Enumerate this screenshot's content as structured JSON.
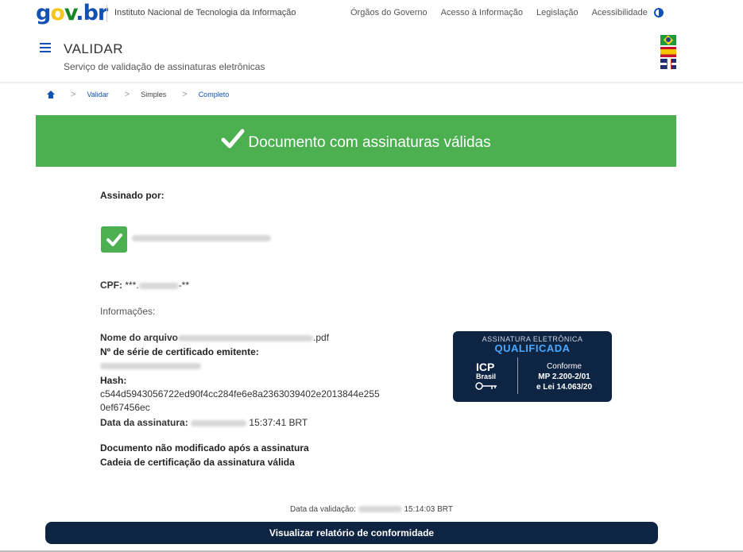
{
  "topbar": {
    "logo": {
      "g": "g",
      "o": "o",
      "v": "v",
      "dot": ".",
      "b": "b",
      "r": "r"
    },
    "institute": "Instituto Nacional de Tecnologia da Informação",
    "nav": [
      "Órgãos do Governo",
      "Acesso à Informação",
      "Legislação",
      "Acessibilidade"
    ],
    "contrast_icon": "contrast-icon"
  },
  "header": {
    "title": "VALIDAR",
    "subtitle": "Serviço de validação de assinaturas eletrônicas",
    "languages": [
      "flag-brazil-icon",
      "flag-spain-icon",
      "flag-uk-icon"
    ]
  },
  "breadcrumb": {
    "home_icon": "home-icon",
    "items": [
      {
        "label": "Validar"
      },
      {
        "label": "Simples"
      },
      {
        "label": "Completo"
      }
    ],
    "separator": ">"
  },
  "banner": {
    "text": "Documento com assinaturas válidas",
    "icon": "checkmark-icon",
    "color": "#4caf50"
  },
  "signature": {
    "signed_by_label": "Assinado por:",
    "cpf_label": "CPF:",
    "cpf_prefix": "***.",
    "cpf_suffix": "-**",
    "info_label": "Informações:",
    "filename_label": "Nome do arquivo",
    "filename_suffix": ".pdf",
    "serial_label": "Nº de série de certificado emitente:",
    "hash_label": "Hash:",
    "hash_line1": "c544d5943056722ed90f4cc284fe6e8a2363039402e2013844e255",
    "hash_line2": "0ef67456ec",
    "date_label": "Data da assinatura:",
    "date_time": "15:37:41 BRT",
    "status1": "Documento não modificado após a assinatura",
    "status2": "Cadeia de certificação da assinatura válida"
  },
  "badge": {
    "line1": "ASSINATURA ELETRÔNICA",
    "line2": "QUALIFICADA",
    "icp": "ICP",
    "brasil": "Brasil",
    "conforme": "Conforme",
    "mp": "MP 2.200-2/01",
    "lei": "e Lei 14.063/20",
    "accent": "#4aa8ff",
    "background": "#0e2443"
  },
  "footer": {
    "validation_label": "Data da validação:",
    "validation_time": "15:14:03 BRT",
    "report_button": "Visualizar relatório de conformidade"
  }
}
